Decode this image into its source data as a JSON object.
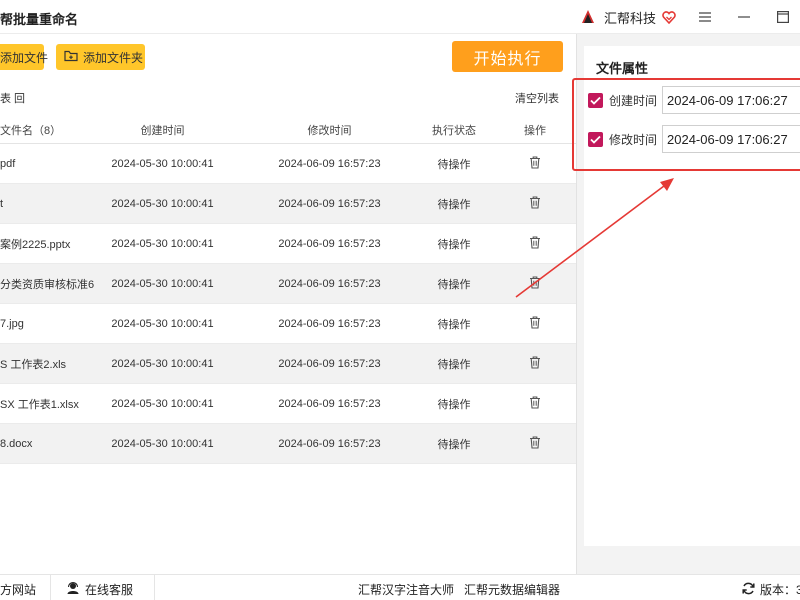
{
  "app": {
    "title": "帮批量重命名",
    "brand_name": "汇帮科技"
  },
  "toolbar": {
    "add_file_label": "添加文件",
    "add_folder_label": "添加文件夹",
    "start_label": "开始执行"
  },
  "list_actions": {
    "first": "表",
    "second": "回",
    "clear": "清空列表"
  },
  "table": {
    "headers": {
      "name": "文件名（8）",
      "created": "创建时间",
      "modified": "修改时间",
      "status": "执行状态",
      "op": "操作"
    },
    "rows": [
      {
        "name": "pdf",
        "created": "2024-05-30 10:00:41",
        "modified": "2024-06-09 16:57:23",
        "status": "待操作"
      },
      {
        "name": "t",
        "created": "2024-05-30 10:00:41",
        "modified": "2024-06-09 16:57:23",
        "status": "待操作"
      },
      {
        "name": "案例2225.pptx",
        "created": "2024-05-30 10:00:41",
        "modified": "2024-06-09 16:57:23",
        "status": "待操作"
      },
      {
        "name": "分类资质审核标准6",
        "created": "2024-05-30 10:00:41",
        "modified": "2024-06-09 16:57:23",
        "status": "待操作"
      },
      {
        "name": "7.jpg",
        "created": "2024-05-30 10:00:41",
        "modified": "2024-06-09 16:57:23",
        "status": "待操作"
      },
      {
        "name": "S 工作表2.xls",
        "created": "2024-05-30 10:00:41",
        "modified": "2024-06-09 16:57:23",
        "status": "待操作"
      },
      {
        "name": "SX 工作表1.xlsx",
        "created": "2024-05-30 10:00:41",
        "modified": "2024-06-09 16:57:23",
        "status": "待操作"
      },
      {
        "name": "8.docx",
        "created": "2024-05-30 10:00:41",
        "modified": "2024-06-09 16:57:23",
        "status": "待操作"
      }
    ]
  },
  "attributes": {
    "title": "文件属性",
    "created_label": "创建时间",
    "created_value": "2024-06-09 17:06:27",
    "modified_label": "修改时间",
    "modified_value": "2024-06-09 17:06:27"
  },
  "footer": {
    "website": "方网站",
    "service": "在线客服",
    "link1": "汇帮汉字注音大师",
    "link2": "汇帮元数据编辑器",
    "version": "版本：3."
  },
  "colors": {
    "accent_yellow": "#ffc62a",
    "accent_orange": "#ff9f1c",
    "checkbox": "#c2185b",
    "highlight_red": "#e53935"
  }
}
